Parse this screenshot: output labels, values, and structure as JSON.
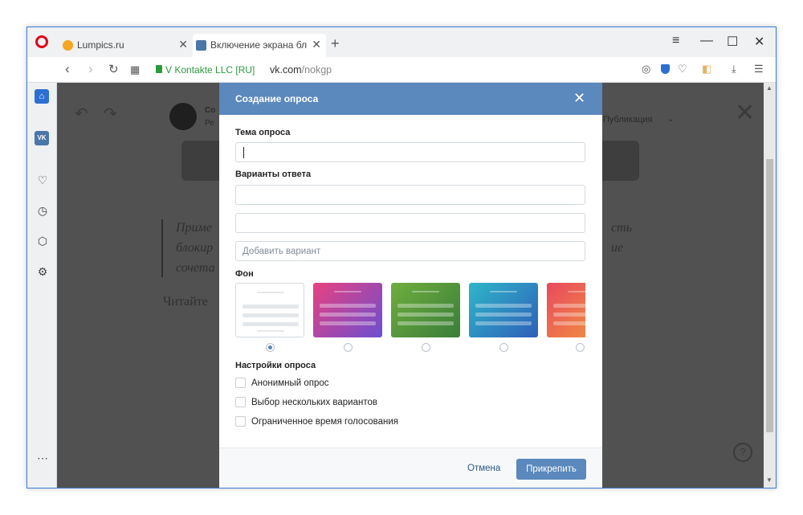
{
  "tabs": [
    {
      "title": "Lumpics.ru",
      "favicon": "lumpics-icon"
    },
    {
      "title": "Включение экрана блокир",
      "favicon": "vk-icon"
    }
  ],
  "address": {
    "secure_label": "V Kontakte LLC [RU]",
    "domain": "vk.com",
    "path": "/nokgp"
  },
  "background": {
    "author_short": "Со",
    "author_sub": "Ре",
    "publication": "Публикация",
    "note_lines": [
      "Приме",
      "блокир",
      "сочета"
    ],
    "note_right": [
      "сть",
      "ие"
    ],
    "read_more": "Читайте"
  },
  "modal": {
    "title": "Создание опроса",
    "topic_label": "Тема опроса",
    "answers_label": "Варианты ответа",
    "add_option_placeholder": "Добавить вариант",
    "bg_label": "Фон",
    "settings_label": "Настройки опроса",
    "settings": [
      "Анонимный опрос",
      "Выбор нескольких вариантов",
      "Ограниченное время голосования"
    ],
    "cancel": "Отмена",
    "attach": "Прикрепить"
  },
  "colors": {
    "accent": "#5b88bd",
    "opera_red": "#e0001a",
    "secure_green": "#2b9a3e"
  }
}
